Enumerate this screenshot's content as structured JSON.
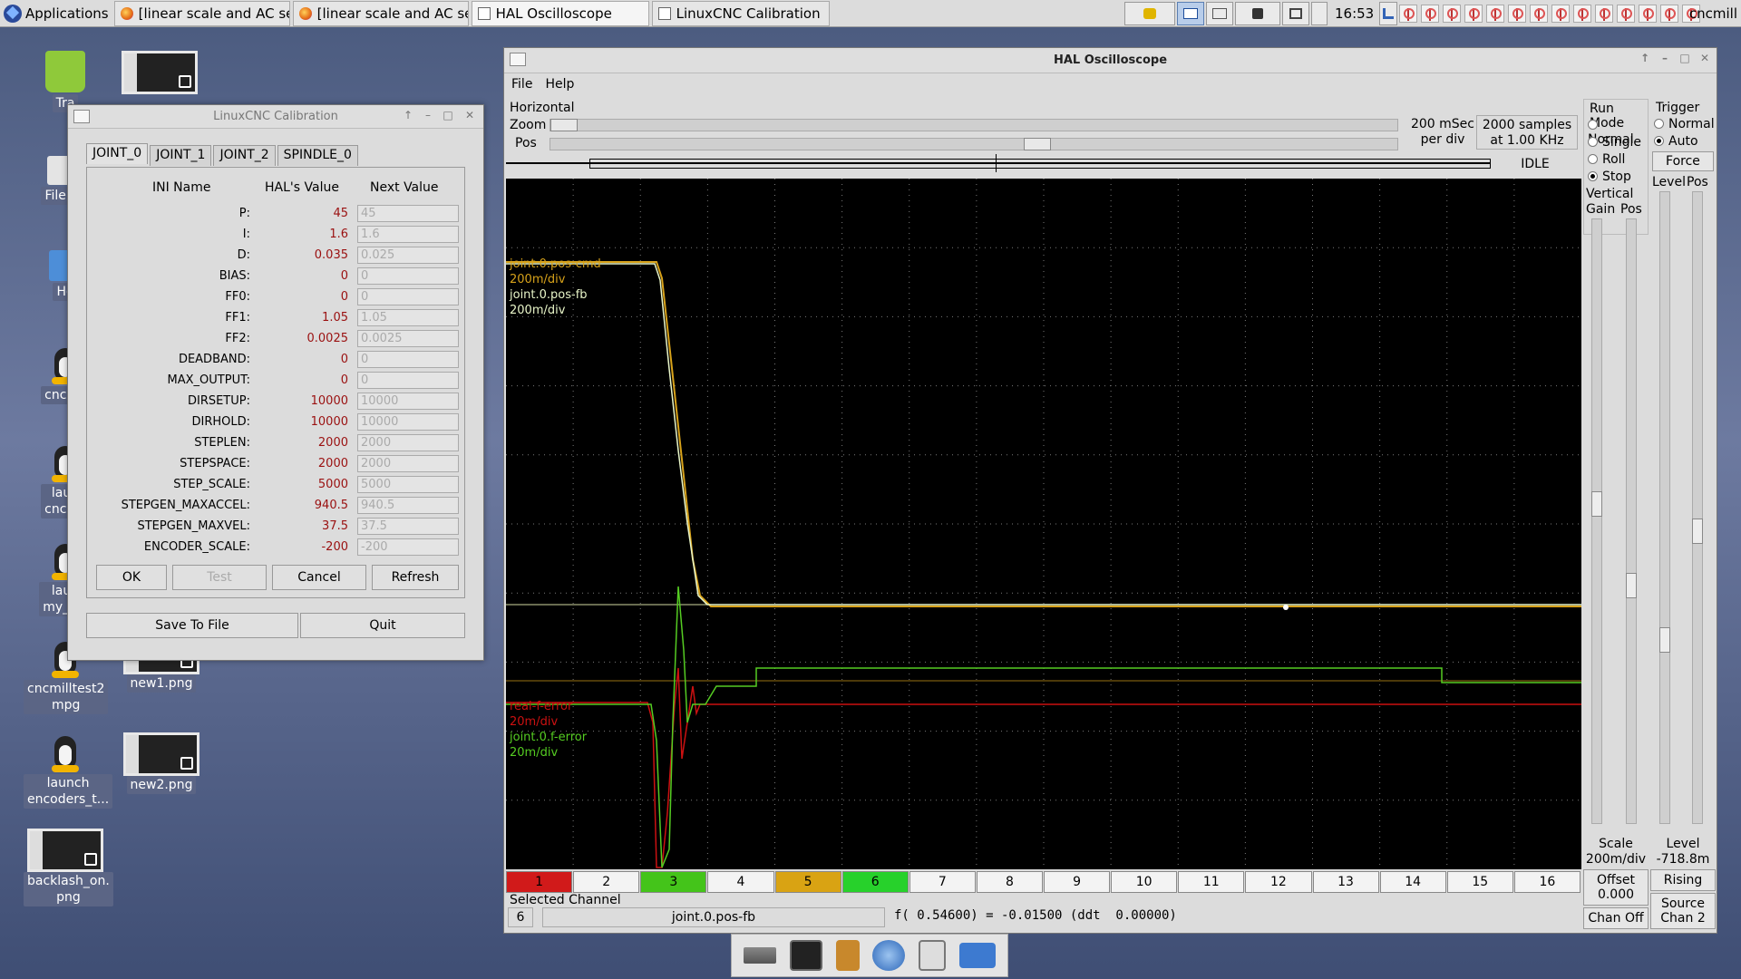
{
  "taskbar": {
    "applications_label": "Applications",
    "tasks": [
      {
        "label": "[linear scale and AC ser..."
      },
      {
        "label": "[linear scale and AC ser..."
      },
      {
        "label": "HAL Oscilloscope"
      },
      {
        "label": "LinuxCNC Calibration"
      }
    ],
    "clock": "16:53",
    "hostname": "cncmill"
  },
  "desktop": {
    "icons": [
      {
        "label": "Tra"
      },
      {
        "label": "File Sy"
      },
      {
        "label": "Ho"
      },
      {
        "label": "cncmil"
      },
      {
        "label": "laun\ncncmil"
      },
      {
        "label": "laun\nmy_Lin"
      },
      {
        "label": "cncmilltest2\nmpg"
      },
      {
        "label": "new1.png"
      },
      {
        "label": "launch\nencoders_t..."
      },
      {
        "label": "new2.png"
      },
      {
        "label": "backlash_on.\npng"
      }
    ]
  },
  "calibration": {
    "title": "LinuxCNC Calibration",
    "tabs": [
      "JOINT_0",
      "JOINT_1",
      "JOINT_2",
      "SPINDLE_0"
    ],
    "headers": {
      "ini": "INI Name",
      "hal": "HAL's Value",
      "next": "Next Value"
    },
    "params": [
      {
        "name": "P:",
        "hal": "45",
        "next": "45"
      },
      {
        "name": "I:",
        "hal": "1.6",
        "next": "1.6"
      },
      {
        "name": "D:",
        "hal": "0.035",
        "next": "0.025"
      },
      {
        "name": "BIAS:",
        "hal": "0",
        "next": "0"
      },
      {
        "name": "FF0:",
        "hal": "0",
        "next": "0"
      },
      {
        "name": "FF1:",
        "hal": "1.05",
        "next": "1.05"
      },
      {
        "name": "FF2:",
        "hal": "0.0025",
        "next": "0.0025"
      },
      {
        "name": "DEADBAND:",
        "hal": "0",
        "next": "0"
      },
      {
        "name": "MAX_OUTPUT:",
        "hal": "0",
        "next": "0"
      },
      {
        "name": "DIRSETUP:",
        "hal": "10000",
        "next": "10000"
      },
      {
        "name": "DIRHOLD:",
        "hal": "10000",
        "next": "10000"
      },
      {
        "name": "STEPLEN:",
        "hal": "2000",
        "next": "2000"
      },
      {
        "name": "STEPSPACE:",
        "hal": "2000",
        "next": "2000"
      },
      {
        "name": "STEP_SCALE:",
        "hal": "5000",
        "next": "5000"
      },
      {
        "name": "STEPGEN_MAXACCEL:",
        "hal": "940.5",
        "next": "940.5"
      },
      {
        "name": "STEPGEN_MAXVEL:",
        "hal": "37.5",
        "next": "37.5"
      },
      {
        "name": "ENCODER_SCALE:",
        "hal": "-200",
        "next": "-200"
      }
    ],
    "buttons": {
      "ok": "OK",
      "test": "Test",
      "cancel": "Cancel",
      "refresh": "Refresh",
      "save": "Save To File",
      "quit": "Quit"
    }
  },
  "scope": {
    "title": "HAL Oscilloscope",
    "menu": {
      "file": "File",
      "help": "Help"
    },
    "horizontal": {
      "label": "Horizontal",
      "zoom_label": "Zoom",
      "pos_label": "Pos",
      "rate_line1": "200 mSec",
      "rate_line2": "per div",
      "samples_line1": "2000 samples",
      "samples_line2": "at 1.00 KHz",
      "state": "IDLE",
      "zoom_value": 0.0,
      "pos_value": 0.58
    },
    "run_mode": {
      "label": "Run Mode",
      "options": [
        "Normal",
        "Single",
        "Roll",
        "Stop"
      ],
      "selected": "Stop"
    },
    "trigger": {
      "label": "Trigger",
      "options": [
        "Normal",
        "Auto"
      ],
      "selected": "Auto",
      "force": "Force",
      "level_label": "Level",
      "pos_label": "Pos"
    },
    "vertical": {
      "label": "Vertical",
      "gain_label": "Gain",
      "pos_label": "Pos",
      "scale_label": "Scale",
      "scale_value": "200m/div",
      "offset_label": "Offset",
      "offset_value": "0.000",
      "chan_off": "Chan Off"
    },
    "trigger_bottom": {
      "level_label": "Level",
      "level_value": "-718.8m",
      "edge": "Rising",
      "source_label": "Source",
      "source_value": "Chan 2"
    },
    "traces": [
      {
        "name": "joint.0.pos-cmd",
        "scale": "200m/div",
        "color": "#d7a21a"
      },
      {
        "name": "joint.0.pos-fb",
        "scale": "200m/div",
        "color": "#e8f5c8"
      },
      {
        "name": "real-f-error",
        "scale": "20m/div",
        "color": "#cc1111"
      },
      {
        "name": "joint.0.f-error",
        "scale": "20m/div",
        "color": "#55cc22"
      }
    ],
    "channels": [
      {
        "n": "1",
        "color": "#d11a1a"
      },
      {
        "n": "2",
        "color": ""
      },
      {
        "n": "3",
        "color": "#44c41a"
      },
      {
        "n": "4",
        "color": ""
      },
      {
        "n": "5",
        "color": "#d9a313"
      },
      {
        "n": "6",
        "color": "#27d12b"
      },
      {
        "n": "7",
        "color": ""
      },
      {
        "n": "8",
        "color": ""
      },
      {
        "n": "9",
        "color": ""
      },
      {
        "n": "10",
        "color": ""
      },
      {
        "n": "11",
        "color": ""
      },
      {
        "n": "12",
        "color": ""
      },
      {
        "n": "13",
        "color": ""
      },
      {
        "n": "14",
        "color": ""
      },
      {
        "n": "15",
        "color": ""
      },
      {
        "n": "16",
        "color": ""
      }
    ],
    "selected_channel": {
      "label": "Selected Channel",
      "number": "6",
      "signal": "joint.0.pos-fb",
      "readout": "f( 0.54600) = -0.01500 (ddt  0.00000)"
    }
  }
}
